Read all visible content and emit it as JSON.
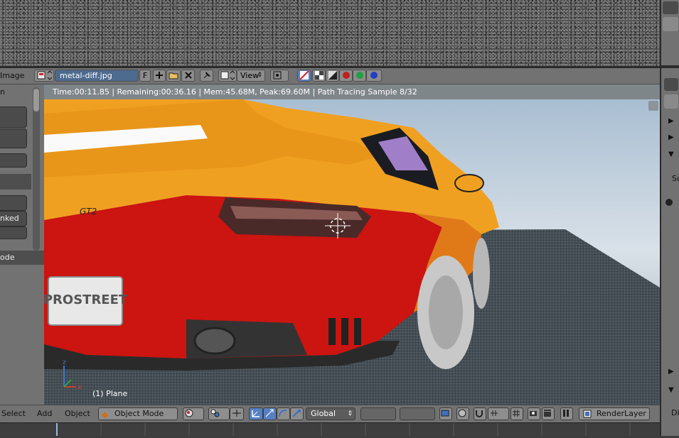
{
  "image_header": {
    "menu_label": "Image",
    "image_name": "metal-diff.jpg",
    "fake_user": "F",
    "view_label": "View"
  },
  "left_panel": {
    "label_top": "n",
    "label_baked": "nked",
    "label_mode": "ode"
  },
  "render_status": "Time:00:11.85 | Remaining:00:36.16 | Mem:45.68M, Peak:69.60M | Path Tracing Sample 8/32",
  "viewport": {
    "object_info": "(1) Plane",
    "license_plate": "PROSTREET",
    "car_badge": "GT2"
  },
  "bottom_header": {
    "select": "Select",
    "add": "Add",
    "object": "Object",
    "mode": "Object Mode",
    "orientation": "Global",
    "render_layer": "RenderLayer"
  },
  "right_panel": {
    "label_su": "Su",
    "label_di": "Di"
  },
  "colors": {
    "car_upper": "#f0a020",
    "car_lower": "#cc1410",
    "ui_gray": "#727272",
    "accent_blue": "#5680c2"
  }
}
